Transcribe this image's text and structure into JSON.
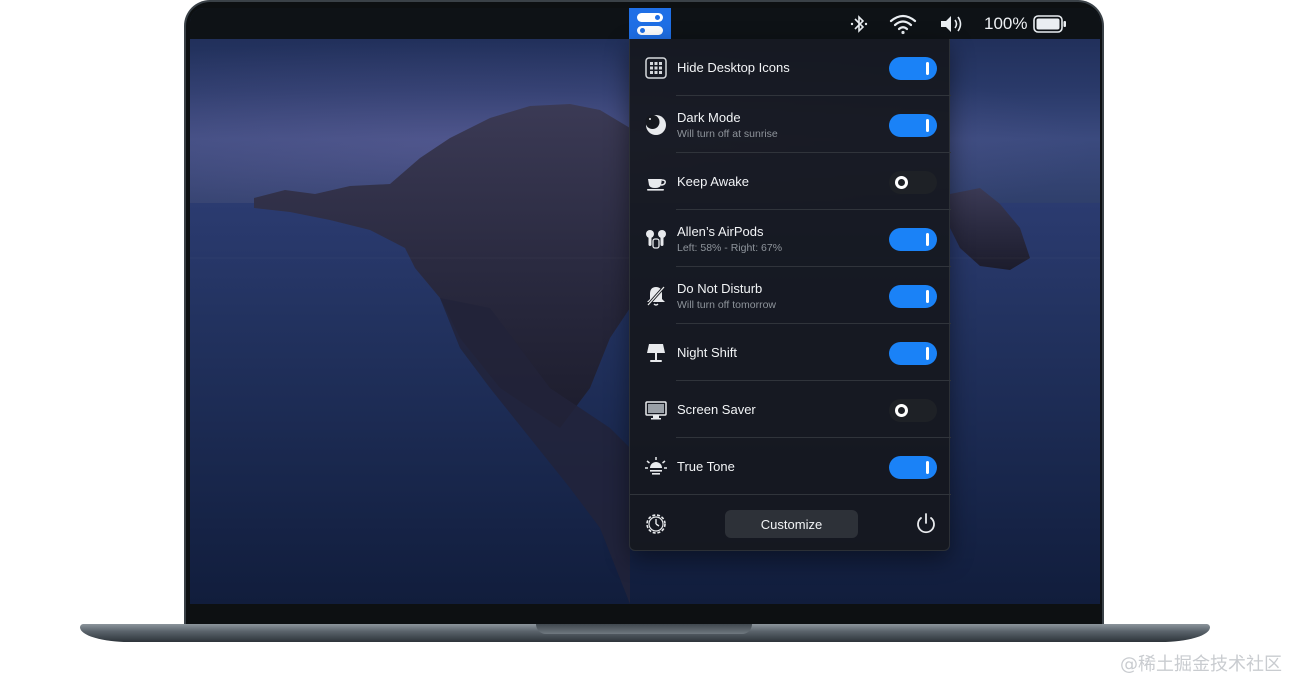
{
  "menubar": {
    "app_icon": "toggles-icon",
    "status_icons": [
      "bluetooth-icon",
      "wifi-icon",
      "volume-icon",
      "battery-icon"
    ],
    "battery_percent": "100%"
  },
  "panel": {
    "items": [
      {
        "icon": "grid-icon",
        "title": "Hide Desktop Icons",
        "subtitle": "",
        "enabled": true
      },
      {
        "icon": "moon-icon",
        "title": "Dark Mode",
        "subtitle": "Will turn off at sunrise",
        "enabled": true
      },
      {
        "icon": "coffee-cup-icon",
        "title": "Keep Awake",
        "subtitle": "",
        "enabled": false
      },
      {
        "icon": "airpods-icon",
        "title": "Allen’s AirPods",
        "subtitle": "Left: 58% - Right: 67%",
        "enabled": true
      },
      {
        "icon": "bell-slash-icon",
        "title": "Do Not Disturb",
        "subtitle": "Will turn off tomorrow",
        "enabled": true
      },
      {
        "icon": "lamp-icon",
        "title": "Night Shift",
        "subtitle": "",
        "enabled": true
      },
      {
        "icon": "monitor-icon",
        "title": "Screen Saver",
        "subtitle": "",
        "enabled": false
      },
      {
        "icon": "sun-icon",
        "title": "True Tone",
        "subtitle": "",
        "enabled": true
      }
    ],
    "footer": {
      "settings_icon": "gear-icon",
      "customize_label": "Customize",
      "power_icon": "power-icon"
    }
  },
  "watermark": "@稀土掘金技术社区",
  "colors": {
    "accent": "#1a82f7",
    "menubar_app_bg": "#1f6fe6",
    "panel_bg": "#16181e"
  }
}
